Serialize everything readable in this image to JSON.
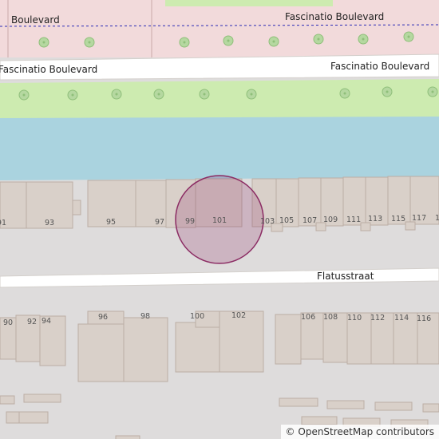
{
  "map": {
    "streets": {
      "top_left": "Boulevard",
      "top_right": "Fascinatio Boulevard",
      "mid_left": "Fascinatio Boulevard",
      "mid_right": "Fascinatio Boulevard",
      "bottom": "Flatusstraat"
    },
    "house_numbers_north": [
      "91",
      "93",
      "95",
      "97",
      "99",
      "101",
      "103",
      "105",
      "107",
      "109",
      "111",
      "113",
      "115",
      "117",
      "1"
    ],
    "house_numbers_south": [
      "90",
      "92",
      "94",
      "96",
      "98",
      "100",
      "102",
      "106",
      "108",
      "110",
      "112",
      "114",
      "116"
    ],
    "marker_color": "#8b2b63",
    "colors": {
      "water": "#aad3df",
      "park": "#cdebb0",
      "residential_pink": "#f2dadb",
      "road": "#ffffff",
      "building": "#d9d0c9",
      "background": "#dedcdc"
    }
  },
  "attribution": {
    "symbol": "©",
    "text": "OpenStreetMap contributors"
  }
}
